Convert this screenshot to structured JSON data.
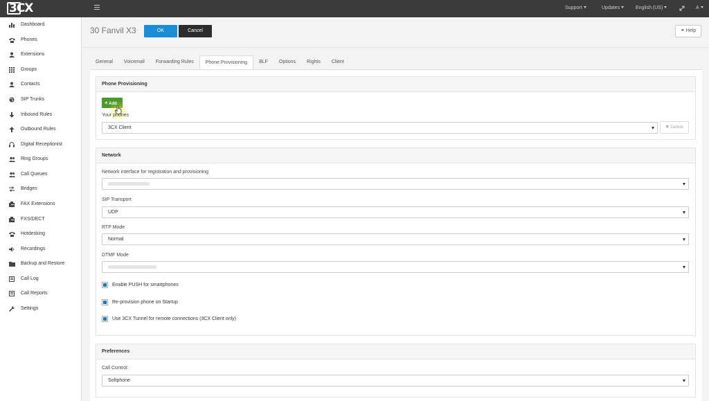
{
  "app": {
    "logo": "3CX"
  },
  "topbar": {
    "support": "Support",
    "updates": "Updates",
    "language": "English (US)",
    "user": "A"
  },
  "sidebar": {
    "items": [
      {
        "label": "Dashboard",
        "icon": "bar-chart-icon"
      },
      {
        "label": "Phones",
        "icon": "phone-icon"
      },
      {
        "label": "Extensions",
        "icon": "user-icon"
      },
      {
        "label": "Groups",
        "icon": "grid-icon"
      },
      {
        "label": "Contacts",
        "icon": "contact-icon"
      },
      {
        "label": "SIP Trunks",
        "icon": "globe-icon"
      },
      {
        "label": "Inbound Rules",
        "icon": "arrow-down-icon"
      },
      {
        "label": "Outbound Rules",
        "icon": "arrow-up-icon"
      },
      {
        "label": "Digital Receptionist",
        "icon": "headset-icon"
      },
      {
        "label": "Ring Groups",
        "icon": "users-icon"
      },
      {
        "label": "Call Queues",
        "icon": "users-icon"
      },
      {
        "label": "Bridges",
        "icon": "exchange-icon"
      },
      {
        "label": "FAX Extensions",
        "icon": "fax-icon"
      },
      {
        "label": "FXS/DECT",
        "icon": "fax-icon"
      },
      {
        "label": "Hotdesking",
        "icon": "phone-icon"
      },
      {
        "label": "Recordings",
        "icon": "volume-icon"
      },
      {
        "label": "Backup and Restore",
        "icon": "folder-icon"
      },
      {
        "label": "Call Log",
        "icon": "list-icon"
      },
      {
        "label": "Call Reports",
        "icon": "report-icon"
      },
      {
        "label": "Settings",
        "icon": "wrench-icon"
      }
    ]
  },
  "header": {
    "title": "30 Fanvil X3",
    "ok_label": "OK",
    "cancel_label": "Cancel",
    "help_label": "Help"
  },
  "tabs": [
    {
      "label": "General",
      "active": false
    },
    {
      "label": "Voicemail",
      "active": false
    },
    {
      "label": "Forwarding Rules",
      "active": false
    },
    {
      "label": "Phone Provisioning",
      "active": true
    },
    {
      "label": "BLF",
      "active": false
    },
    {
      "label": "Options",
      "active": false
    },
    {
      "label": "Rights",
      "active": false
    },
    {
      "label": "Client",
      "active": false
    }
  ],
  "provisioning": {
    "heading": "Phone Provisioning",
    "add_label": "Add",
    "your_phones_label": "Your phones",
    "your_phones_value": "3CX Client",
    "delete_label": "Delete"
  },
  "network": {
    "heading": "Network",
    "interface_label": "Network interface for registration and provisioning",
    "sip_transport_label": "SIP Transport",
    "sip_transport_value": "UDP",
    "rtp_mode_label": "RTP Mode",
    "rtp_mode_value": "Normal",
    "dtmf_mode_label": "DTMF Mode",
    "push_label": "Enable PUSH for smartphones",
    "reprovision_label": "Re-provision phone on Startup",
    "tunnel_label": "Use 3CX Tunnel for remote connections (3CX Client only)"
  },
  "preferences": {
    "heading": "Preferences",
    "call_control_label": "Call Control:",
    "call_control_value": "Softphone"
  }
}
